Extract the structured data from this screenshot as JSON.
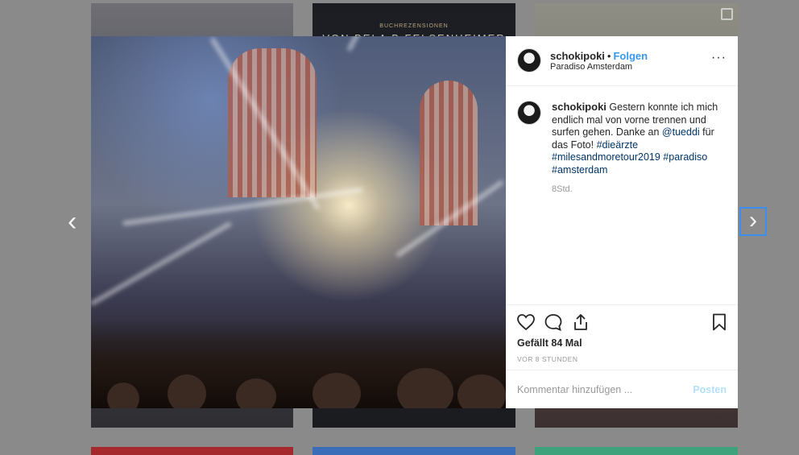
{
  "background": {
    "tile2_caption": "BUCHREZENSIONEN",
    "tile2_headline": "VON BELA B FELSENHEIMER"
  },
  "nav": {
    "prev_glyph": "‹",
    "next_glyph": "›"
  },
  "post": {
    "username": "schokipoki",
    "separator": "•",
    "follow_label": "Folgen",
    "location": "Paradiso Amsterdam",
    "more_glyph": "···",
    "caption": {
      "username": "schokipoki",
      "text_1": "Gestern konnte ich mich endlich mal von vorne trennen und surfen gehen. Danke an",
      "mention": "@tueddi",
      "text_2": "für das Foto!",
      "hashtags": [
        "#dieärzte",
        "#milesandmoretour2019",
        "#paradiso",
        "#amsterdam"
      ]
    },
    "caption_time": "8Std.",
    "likes": "Gefällt 84 Mal",
    "posted_ago": "VOR 8 STUNDEN",
    "comment_placeholder": "Kommentar hinzufügen ...",
    "post_button": "Posten"
  },
  "colors": {
    "accent": "#3897f0",
    "link": "#003569",
    "post_disabled": "#b2dffc"
  },
  "icons": [
    "heart-icon",
    "comment-icon",
    "share-icon",
    "bookmark-icon",
    "more-options-icon",
    "chevron-left-icon",
    "chevron-right-icon"
  ]
}
